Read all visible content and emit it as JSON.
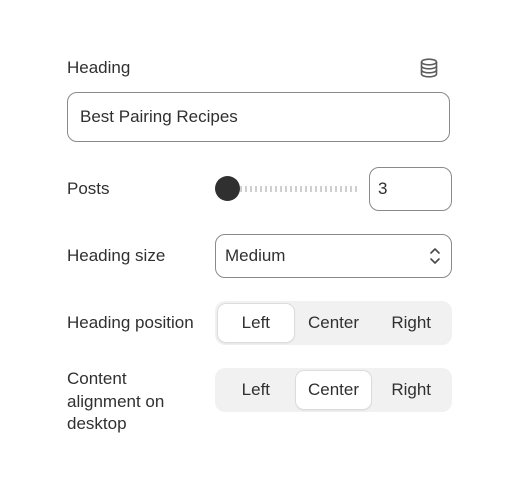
{
  "heading": {
    "label": "Heading",
    "value": "Best Pairing Recipes",
    "dynamic_source_icon": "database-icon"
  },
  "posts": {
    "label": "Posts",
    "slider_fraction": 0.0,
    "value": "3"
  },
  "heading_size": {
    "label": "Heading size",
    "selected": "Medium",
    "icon": "chevron-up-down-icon"
  },
  "heading_position": {
    "label": "Heading position",
    "options": [
      "Left",
      "Center",
      "Right"
    ],
    "selected": "Left"
  },
  "content_alignment": {
    "label": "Content alignment on desktop",
    "options": [
      "Left",
      "Center",
      "Right"
    ],
    "selected": "Center"
  },
  "colors": {
    "text": "#303030",
    "border": "#8a8a8a",
    "segment_bg": "#f1f1f1",
    "slider_thumb": "#303030"
  }
}
